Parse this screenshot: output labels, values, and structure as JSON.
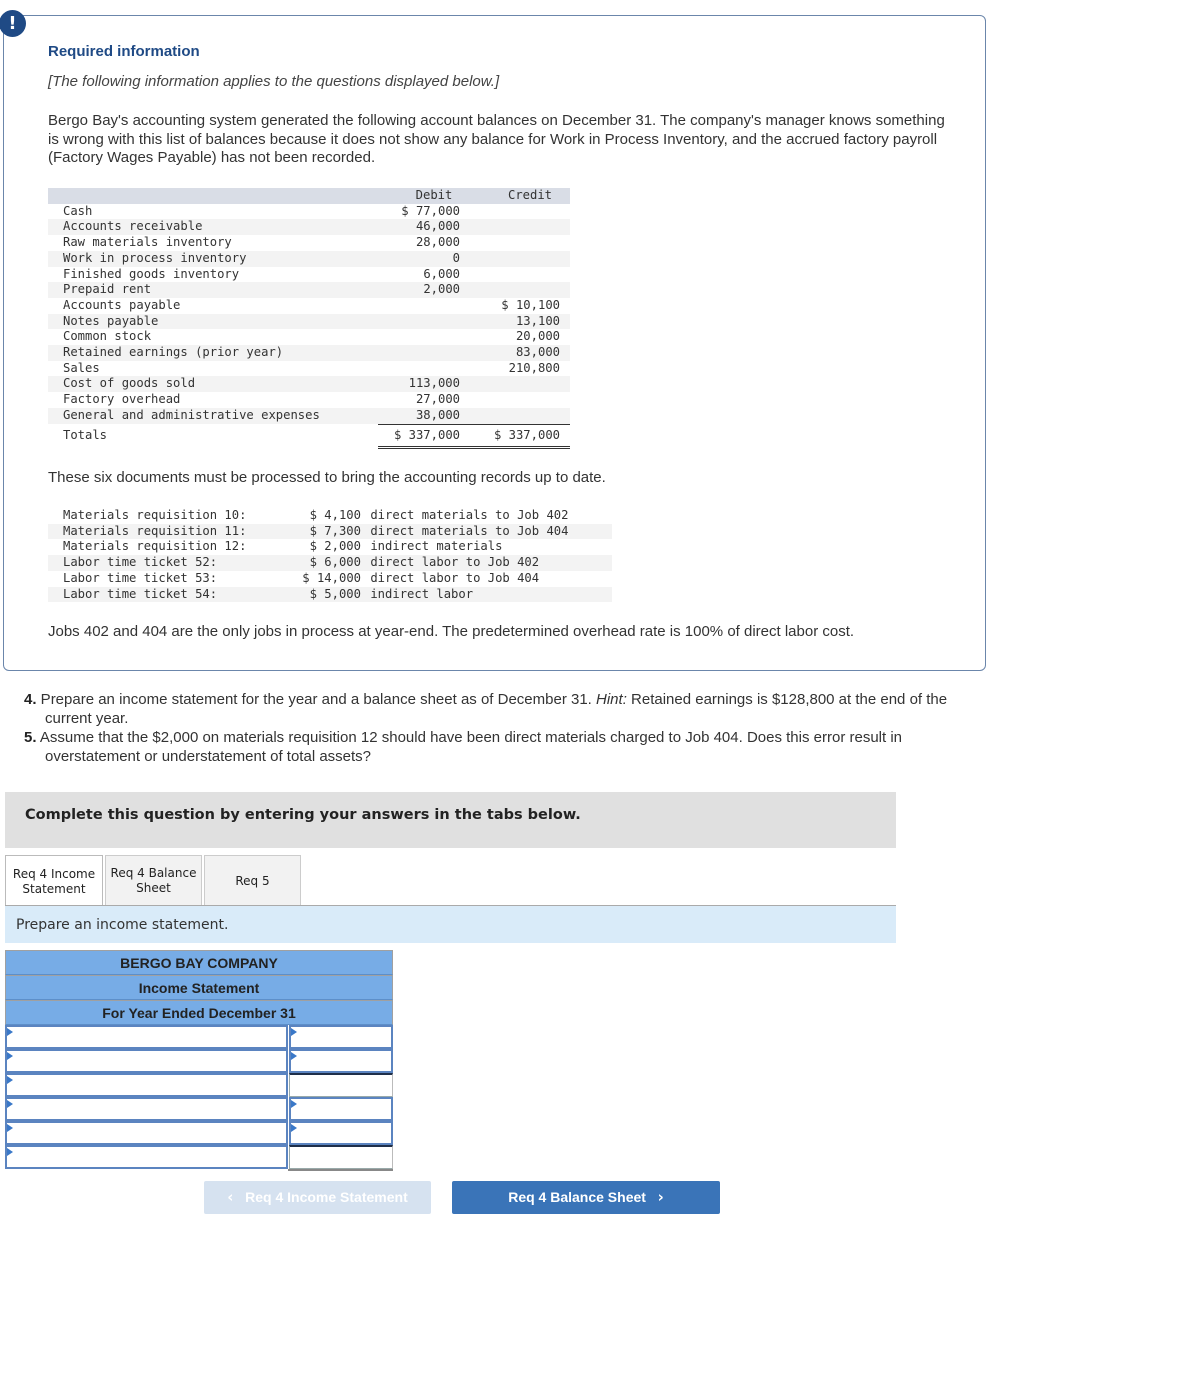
{
  "info": {
    "alert_icon": "!",
    "title": "Required information",
    "subtitle": "[The following information applies to the questions displayed below.]",
    "intro": "Bergo Bay's accounting system generated the following account balances on December 31. The company's manager knows something is wrong with this list of balances because it does not show any balance for Work in Process Inventory, and the accrued factory payroll (Factory Wages Payable) has not been recorded."
  },
  "trial_balance": {
    "headers": {
      "account": "",
      "debit": "Debit",
      "credit": "Credit"
    },
    "rows": [
      {
        "account": "Cash",
        "debit": "$ 77,000",
        "credit": ""
      },
      {
        "account": "Accounts receivable",
        "debit": "46,000",
        "credit": ""
      },
      {
        "account": "Raw materials inventory",
        "debit": "28,000",
        "credit": ""
      },
      {
        "account": "Work in process inventory",
        "debit": "0",
        "credit": ""
      },
      {
        "account": "Finished goods inventory",
        "debit": "6,000",
        "credit": ""
      },
      {
        "account": "Prepaid rent",
        "debit": "2,000",
        "credit": ""
      },
      {
        "account": "Accounts payable",
        "debit": "",
        "credit": "$ 10,100"
      },
      {
        "account": "Notes payable",
        "debit": "",
        "credit": "13,100"
      },
      {
        "account": "Common stock",
        "debit": "",
        "credit": "20,000"
      },
      {
        "account": "Retained earnings (prior year)",
        "debit": "",
        "credit": "83,000"
      },
      {
        "account": "Sales",
        "debit": "",
        "credit": "210,800"
      },
      {
        "account": "Cost of goods sold",
        "debit": "113,000",
        "credit": ""
      },
      {
        "account": "Factory overhead",
        "debit": "27,000",
        "credit": ""
      },
      {
        "account": "General and administrative expenses",
        "debit": "38,000",
        "credit": ""
      }
    ],
    "totals": {
      "account": "Totals",
      "debit": "$ 337,000",
      "credit": "$ 337,000"
    }
  },
  "documents": {
    "intro": "These six documents must be processed to bring the accounting records up to date.",
    "rows": [
      {
        "name": "Materials requisition 10:",
        "amount": "$ 4,100",
        "description": "direct materials to Job 402"
      },
      {
        "name": "Materials requisition 11:",
        "amount": "$ 7,300",
        "description": "direct materials to Job 404"
      },
      {
        "name": "Materials requisition 12:",
        "amount": "$ 2,000",
        "description": "indirect materials"
      },
      {
        "name": "Labor time ticket 52:",
        "amount": "$ 6,000",
        "description": "direct labor to Job 402"
      },
      {
        "name": "Labor time ticket 53:",
        "amount": "$ 14,000",
        "description": "direct labor to Job 404"
      },
      {
        "name": "Labor time ticket 54:",
        "amount": "$ 5,000",
        "description": "indirect labor"
      }
    ],
    "note": "Jobs 402 and 404 are the only jobs in process at year-end. The predetermined overhead rate is 100% of direct labor cost."
  },
  "questions": [
    {
      "num": "4.",
      "text_before": " Prepare an income statement for the year and a balance sheet as of December 31. ",
      "hint_label": "Hint:",
      "text_after": " Retained earnings is $128,800 at the end of the current year."
    },
    {
      "num": "5.",
      "text_before": " Assume that the $2,000 on materials requisition 12 should have been direct materials charged to Job 404. Does this error result in overstatement or understatement of total assets?",
      "hint_label": "",
      "text_after": ""
    }
  ],
  "complete_banner": "Complete this question by entering your answers in the tabs below.",
  "tabs": [
    {
      "line1": "Req 4 Income",
      "line2": "Statement",
      "active": true
    },
    {
      "line1": "Req 4 Balance",
      "line2": "Sheet",
      "active": false
    },
    {
      "line1": "Req 5",
      "line2": "",
      "active": false
    }
  ],
  "instruction": "Prepare an income statement.",
  "income_statement": {
    "company": "BERGO BAY COMPANY",
    "title": "Income Statement",
    "period": "For Year Ended December 31",
    "rows": [
      {
        "label": "",
        "amount": "",
        "amount_dropdown": true
      },
      {
        "label": "",
        "amount": "",
        "amount_dropdown": true
      },
      {
        "label": "",
        "amount": "",
        "amount_dropdown": false
      },
      {
        "label": "",
        "amount": "",
        "amount_dropdown": true
      },
      {
        "label": "",
        "amount": "",
        "amount_dropdown": true
      },
      {
        "label": "",
        "amount": "",
        "amount_dropdown": false
      }
    ]
  },
  "nav": {
    "prev_label": "Req 4 Income Statement",
    "next_label": "Req 4 Balance Sheet",
    "prev_icon": "‹",
    "next_icon": "›"
  }
}
